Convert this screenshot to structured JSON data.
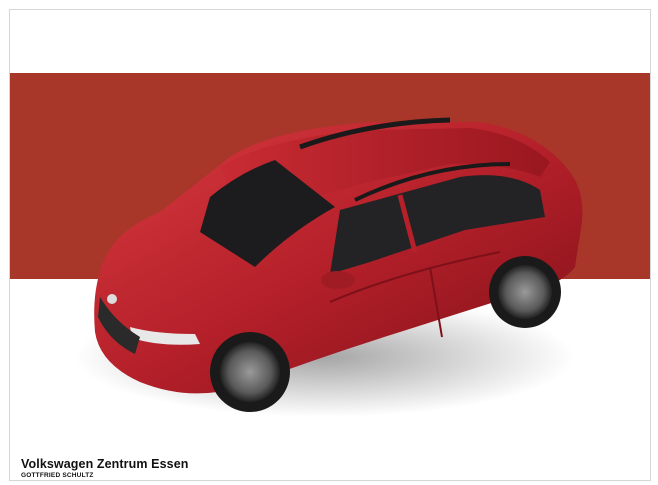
{
  "dealer": {
    "name": "Volkswagen Zentrum Essen",
    "group": "GOTTFRIED SCHULTZ"
  },
  "colors": {
    "band": "#a8372a",
    "car_body": "#b5202a",
    "car_dark": "#7d1018",
    "glass": "#1c1c1e"
  },
  "image": {
    "subject": "red-vw-taigo-top-view"
  }
}
